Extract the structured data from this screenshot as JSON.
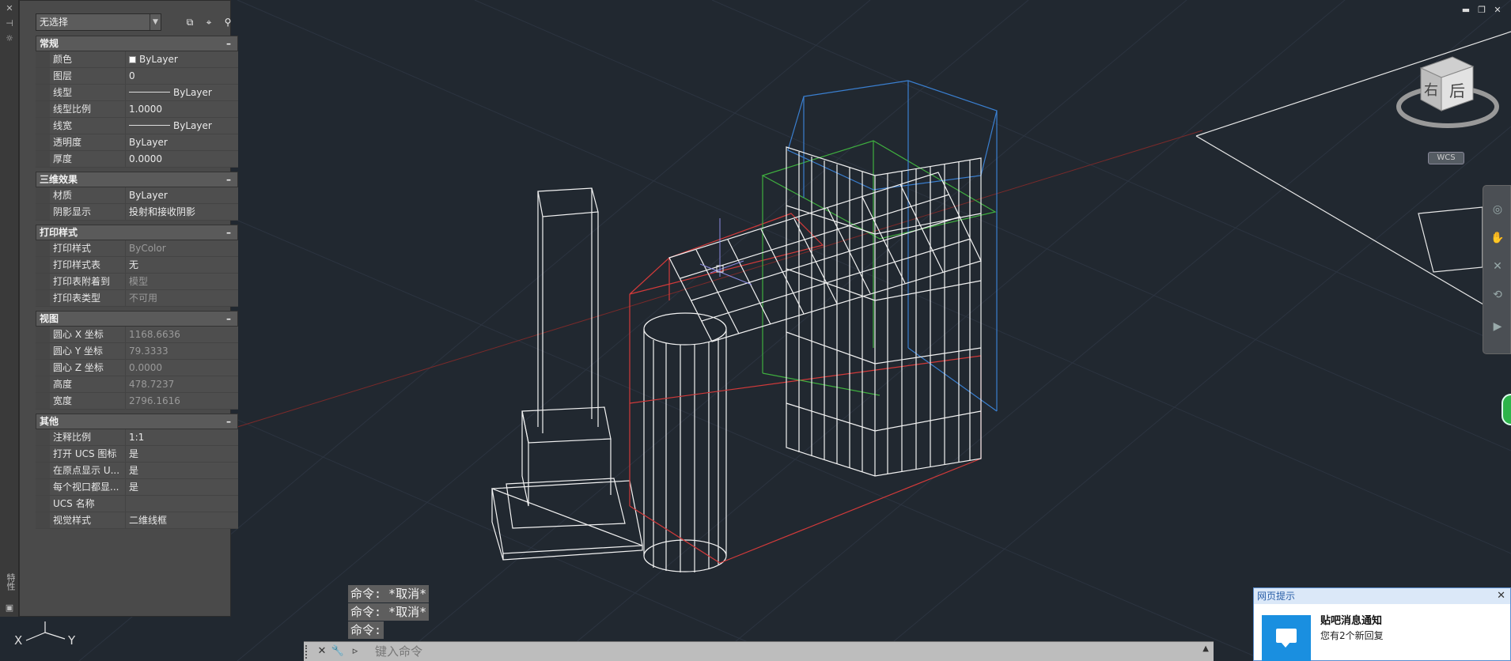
{
  "palette": {
    "selector_value": "无选择",
    "side_label": "特性",
    "groups": [
      {
        "title": "常规",
        "rows": [
          {
            "label": "颜色",
            "value": "ByLayer",
            "kind": "color"
          },
          {
            "label": "图层",
            "value": "0"
          },
          {
            "label": "线型",
            "value": "ByLayer",
            "kind": "line"
          },
          {
            "label": "线型比例",
            "value": "1.0000"
          },
          {
            "label": "线宽",
            "value": "ByLayer",
            "kind": "line"
          },
          {
            "label": "透明度",
            "value": "ByLayer"
          },
          {
            "label": "厚度",
            "value": "0.0000"
          }
        ]
      },
      {
        "title": "三维效果",
        "rows": [
          {
            "label": "材质",
            "value": "ByLayer"
          },
          {
            "label": "阴影显示",
            "value": "投射和接收阴影"
          }
        ]
      },
      {
        "title": "打印样式",
        "rows": [
          {
            "label": "打印样式",
            "value": "ByColor",
            "dim": true
          },
          {
            "label": "打印样式表",
            "value": "无"
          },
          {
            "label": "打印表附着到",
            "value": "模型",
            "dim": true
          },
          {
            "label": "打印表类型",
            "value": "不可用",
            "dim": true
          }
        ]
      },
      {
        "title": "视图",
        "rows": [
          {
            "label": "圆心 X 坐标",
            "value": "1168.6636",
            "dim": true
          },
          {
            "label": "圆心 Y 坐标",
            "value": "79.3333",
            "dim": true
          },
          {
            "label": "圆心 Z 坐标",
            "value": "0.0000",
            "dim": true
          },
          {
            "label": "高度",
            "value": "478.7237",
            "dim": true
          },
          {
            "label": "宽度",
            "value": "2796.1616",
            "dim": true
          }
        ]
      },
      {
        "title": "其他",
        "rows": [
          {
            "label": "注释比例",
            "value": "1:1"
          },
          {
            "label": "打开 UCS 图标",
            "value": "是"
          },
          {
            "label": "在原点显示 U...",
            "value": "是"
          },
          {
            "label": "每个视口都显...",
            "value": "是"
          },
          {
            "label": "UCS 名称",
            "value": ""
          },
          {
            "label": "视觉样式",
            "value": "二维线框"
          }
        ]
      }
    ]
  },
  "command": {
    "history": [
      "命令: *取消*",
      "命令: *取消*",
      "命令:"
    ],
    "placeholder": "键入命令"
  },
  "viewcube": {
    "face_right": "右",
    "face_back": "后",
    "wcs_label": "WCS"
  },
  "ucs": {
    "x_label": "X",
    "y_label": "Y"
  },
  "notification": {
    "title": "网页提示",
    "heading": "贴吧消息通知",
    "body": "您有2个新回复"
  },
  "colors": {
    "background": "#212830",
    "wire_white": "#ffffff",
    "wire_red": "#d23a3a",
    "wire_green": "#3fae3f",
    "wire_blue": "#3a7fd0"
  }
}
